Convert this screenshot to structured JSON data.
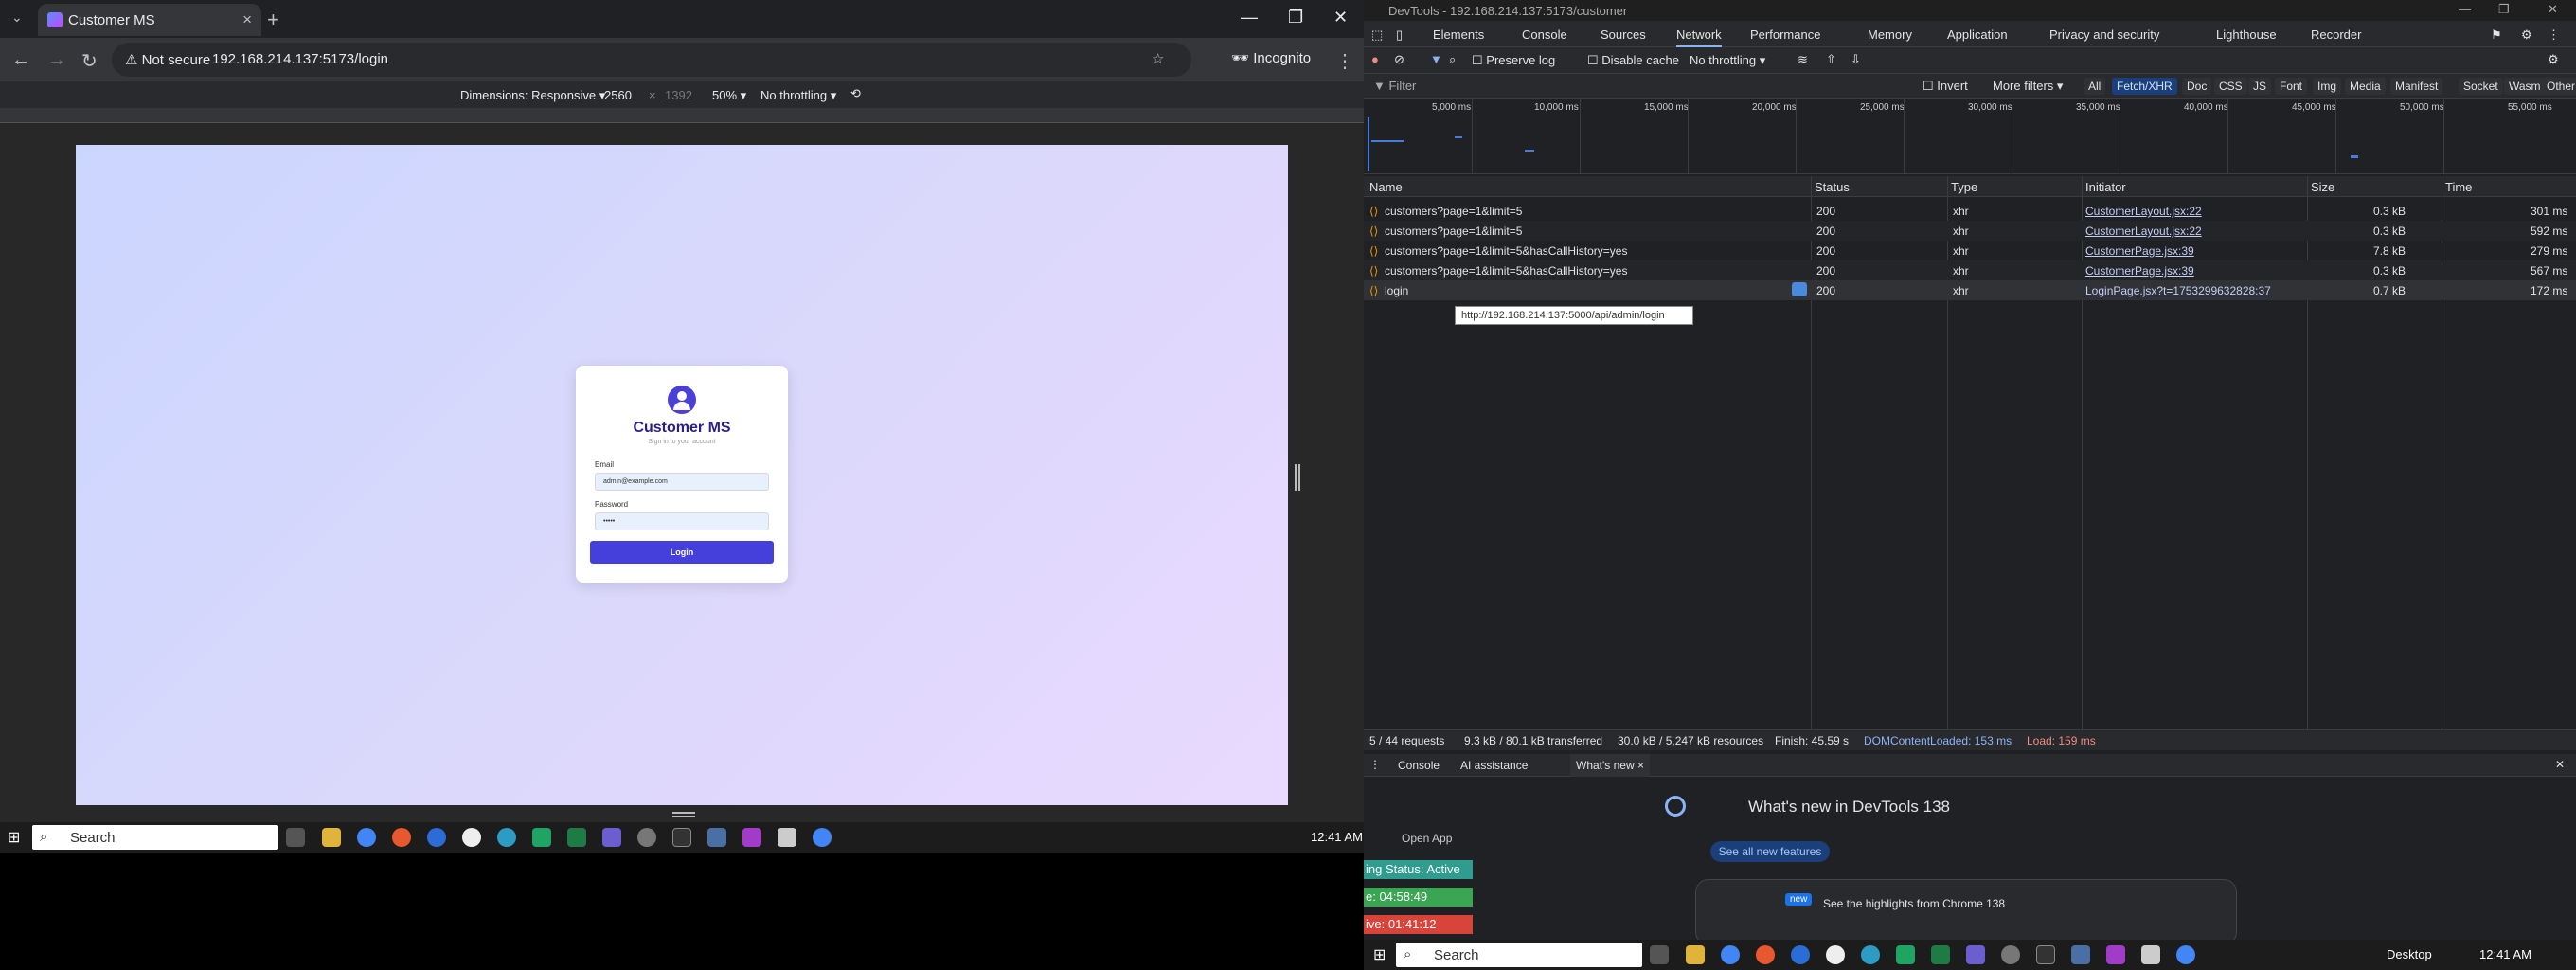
{
  "browser": {
    "tab_title": "Customer MS",
    "not_secure": "Not secure",
    "url": "192.168.214.137:5173/login",
    "incognito": "Incognito",
    "device_bar": {
      "dimensions": "Dimensions: Responsive",
      "width": "2560",
      "height": "1392",
      "zoom": "50%",
      "throttle": "No throttling"
    }
  },
  "login": {
    "title": "Customer MS",
    "subtitle": "Sign in to your account",
    "email_label": "Email",
    "email_value": "admin@example.com",
    "password_label": "Password",
    "password_value": "•••••",
    "button": "Login",
    "gradient_colors": [
      "#cbd6ff",
      "#e9d9ff"
    ],
    "accent": "#4540dc"
  },
  "taskbar_left": {
    "search": "Search",
    "clock": "12:41 AM"
  },
  "devtools": {
    "window_title": "DevTools - 192.168.214.137:5173/customer",
    "tabs": [
      "Elements",
      "Console",
      "Sources",
      "Network",
      "Performance",
      "Memory",
      "Application",
      "Privacy and security",
      "Lighthouse",
      "Recorder"
    ],
    "active_tab": "Network",
    "preserve_log": "Preserve log",
    "disable_cache": "Disable cache",
    "throttle": "No throttling",
    "filter_placeholder": "Filter",
    "invert": "Invert",
    "more_filters": "More filters",
    "type_filters": [
      "All",
      "Fetch/XHR",
      "Doc",
      "CSS",
      "JS",
      "Font",
      "Img",
      "Media",
      "Manifest",
      "Socket",
      "Wasm",
      "Other"
    ],
    "timeline_ticks": [
      "5,000 ms",
      "10,000 ms",
      "15,000 ms",
      "20,000 ms",
      "25,000 ms",
      "30,000 ms",
      "35,000 ms",
      "40,000 ms",
      "45,000 ms",
      "50,000 ms",
      "55,000 ms"
    ],
    "columns": [
      "Name",
      "Status",
      "Type",
      "Initiator",
      "Size",
      "Time"
    ],
    "rows": [
      {
        "name": "customers?page=1&limit=5",
        "status": "200",
        "type": "xhr",
        "initiator": "CustomerLayout.jsx:22",
        "size": "0.3 kB",
        "time": "301 ms"
      },
      {
        "name": "customers?page=1&limit=5",
        "status": "200",
        "type": "xhr",
        "initiator": "CustomerLayout.jsx:22",
        "size": "0.3 kB",
        "time": "592 ms"
      },
      {
        "name": "customers?page=1&limit=5&hasCallHistory=yes",
        "status": "200",
        "type": "xhr",
        "initiator": "CustomerPage.jsx:39",
        "size": "7.8 kB",
        "time": "279 ms"
      },
      {
        "name": "customers?page=1&limit=5&hasCallHistory=yes",
        "status": "200",
        "type": "xhr",
        "initiator": "CustomerPage.jsx:39",
        "size": "0.3 kB",
        "time": "567 ms"
      },
      {
        "name": "login",
        "status": "200",
        "type": "xhr",
        "initiator": "LoginPage.jsx?t=1753299632828:37",
        "size": "0.7 kB",
        "time": "172 ms"
      }
    ],
    "tooltip": "http://192.168.214.137:5000/api/admin/login",
    "status_bar": {
      "requests": "5 / 44 requests",
      "transferred": "9.3 kB / 80.1 kB transferred",
      "resources": "30.0 kB / 5,247 kB resources",
      "finish": "Finish: 45.59 s",
      "dcl": "DOMContentLoaded: 153 ms",
      "load": "Load: 159 ms"
    },
    "drawer_tabs": [
      "Console",
      "AI assistance",
      "What's new"
    ],
    "whats_new_title": "What's new in DevTools 138",
    "see_all": "See all new features",
    "new_badge": "new",
    "highlights": "See the highlights from Chrome 138"
  },
  "overlay": {
    "open_app": "Open App",
    "status": "ing Status: Active",
    "timer1": "e: 04:58:49",
    "timer2": "ive: 01:41:12"
  },
  "taskbar_right": {
    "search": "Search",
    "desktop": "Desktop",
    "clock": "12:41 AM"
  }
}
